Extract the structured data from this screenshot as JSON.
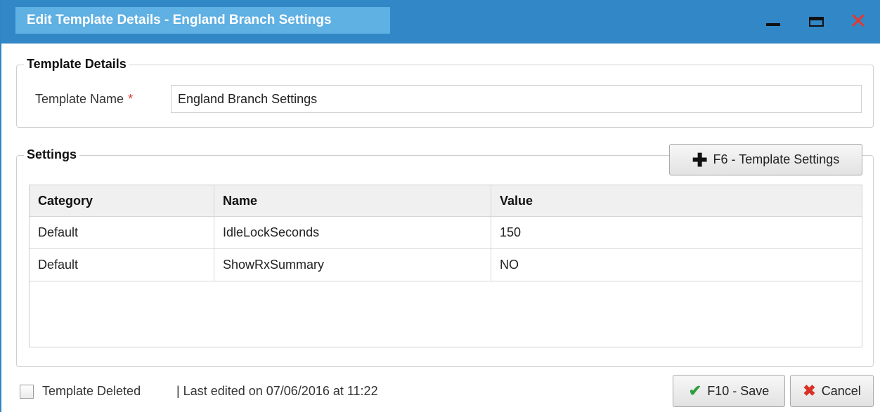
{
  "window": {
    "title": "Edit Template Details - England Branch Settings",
    "icons": {
      "minimize": "minimize-icon",
      "maximize": "maximize-icon",
      "close": "close-icon"
    }
  },
  "template_details": {
    "legend": "Template Details",
    "name_label": "Template Name",
    "required_mark": "*",
    "name_value": "England Branch Settings"
  },
  "settings": {
    "legend": "Settings",
    "add_button_label": "F6 - Template Settings",
    "add_button_icon": "plus-icon",
    "columns": [
      "Category",
      "Name",
      "Value"
    ],
    "rows": [
      [
        "Default",
        "IdleLockSeconds",
        "150"
      ],
      [
        "Default",
        "ShowRxSummary",
        "NO"
      ]
    ]
  },
  "footer": {
    "deleted_label": "Template Deleted",
    "deleted_checked": false,
    "last_edited": "| Last edited on 07/06/2016 at 11:22",
    "save_label": "F10 - Save",
    "save_icon": "checkmark-icon",
    "cancel_label": "Cancel",
    "cancel_icon": "x-icon"
  },
  "colors": {
    "titlebar": "#3287c6",
    "title_tab": "#5fb0e3",
    "close": "#e8372a",
    "required": "#e53935",
    "save_check": "#2e9e3c",
    "cancel_x": "#d93025"
  }
}
